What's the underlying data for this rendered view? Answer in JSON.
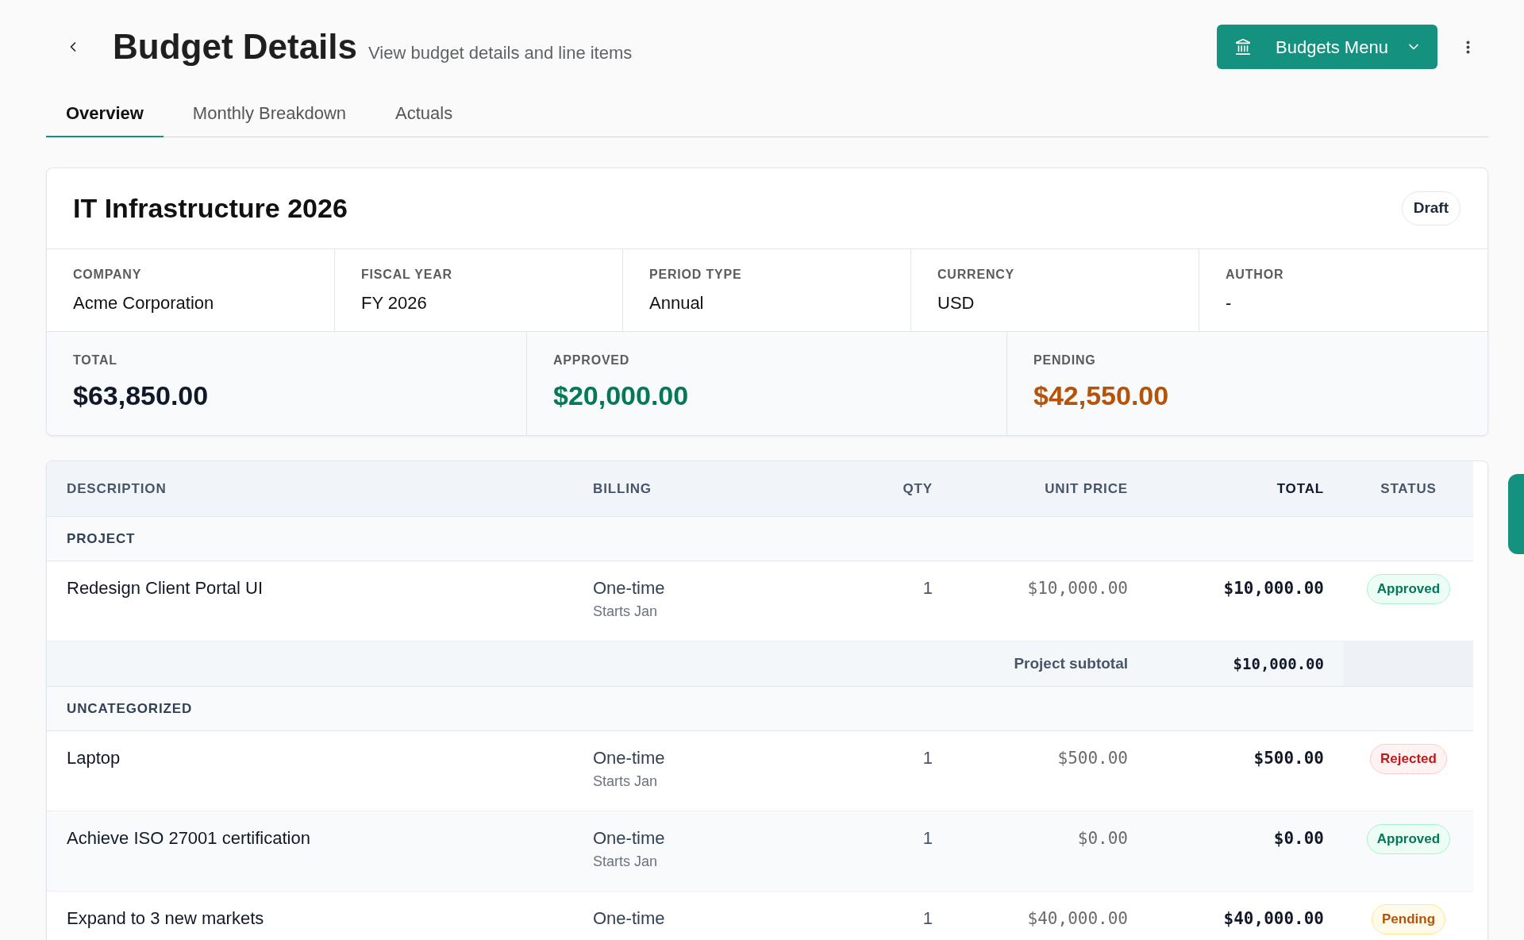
{
  "header": {
    "title": "Budget Details",
    "subtitle": "View budget details and line items",
    "menu_button": "Budgets Menu"
  },
  "tabs": [
    {
      "label": "Overview",
      "selected": true
    },
    {
      "label": "Monthly Breakdown",
      "selected": false
    },
    {
      "label": "Actuals",
      "selected": false
    }
  ],
  "budget": {
    "name": "IT Infrastructure 2026",
    "status": {
      "label": "Draft",
      "kind": "draft"
    },
    "fields": [
      {
        "label": "COMPANY",
        "value": "Acme Corporation"
      },
      {
        "label": "FISCAL YEAR",
        "value": "FY 2026"
      },
      {
        "label": "PERIOD TYPE",
        "value": "Annual"
      },
      {
        "label": "CURRENCY",
        "value": "USD"
      },
      {
        "label": "AUTHOR",
        "value": "-"
      }
    ],
    "totals": [
      {
        "label": "TOTAL",
        "value": "$63,850.00",
        "color": "#111827"
      },
      {
        "label": "APPROVED",
        "value": "$20,000.00",
        "color": "#047857"
      },
      {
        "label": "PENDING",
        "value": "$42,550.00",
        "color": "#b45309"
      }
    ]
  },
  "line_items": {
    "columns": [
      {
        "label": "DESCRIPTION",
        "active": false
      },
      {
        "label": "BILLING",
        "active": false
      },
      {
        "label": "QTY",
        "active": false
      },
      {
        "label": "UNIT PRICE",
        "active": false
      },
      {
        "label": "TOTAL",
        "active": true
      },
      {
        "label": "STATUS",
        "active": false
      }
    ],
    "groups": [
      {
        "name": "PROJECT",
        "rows": [
          {
            "description": "Redesign Client Portal UI",
            "billing": "One-time",
            "billing_note": "Starts Jan",
            "qty": "1",
            "unit_price": "$10,000.00",
            "total": "$10,000.00",
            "status": {
              "label": "Approved",
              "kind": "approved"
            }
          }
        ],
        "subtotal": {
          "label": "Project subtotal",
          "value": "$10,000.00"
        }
      },
      {
        "name": "UNCATEGORIZED",
        "rows": [
          {
            "description": "Laptop",
            "billing": "One-time",
            "billing_note": "Starts Jan",
            "qty": "1",
            "unit_price": "$500.00",
            "total": "$500.00",
            "status": {
              "label": "Rejected",
              "kind": "rejected"
            }
          },
          {
            "description": "Achieve ISO 27001 certification",
            "billing": "One-time",
            "billing_note": "Starts Jan",
            "qty": "1",
            "unit_price": "$0.00",
            "total": "$0.00",
            "status": {
              "label": "Approved",
              "kind": "approved"
            }
          },
          {
            "description": "Expand to 3 new markets",
            "billing": "One-time",
            "qty": "1",
            "unit_price": "$40,000.00",
            "total": "$40,000.00",
            "status": {
              "label": "Pending",
              "kind": "pending"
            }
          }
        ]
      }
    ]
  }
}
